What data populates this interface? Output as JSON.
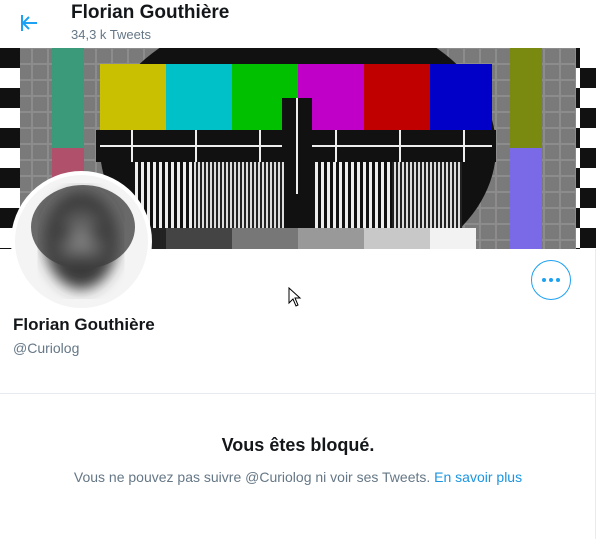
{
  "header": {
    "back_icon": "arrow-left-icon",
    "name": "Florian Gouthière",
    "tweet_count": "34,3 k Tweets"
  },
  "banner": {
    "image": "tv-test-card",
    "colors": {
      "yellow": "#c8c000",
      "cyan": "#00c0c8",
      "green": "#00c000",
      "magenta": "#c000c8",
      "red": "#c00000",
      "blue": "#0000c8"
    }
  },
  "profile": {
    "avatar": "blurred-portrait",
    "name": "Florian Gouthière",
    "handle": "@Curiolog",
    "more_icon": "more-horizontal-icon"
  },
  "blocked": {
    "title": "Vous êtes bloqué.",
    "message": "Vous ne pouvez pas suivre @Curiolog ni voir ses Tweets. ",
    "link_label": "En savoir plus"
  },
  "colors": {
    "accent": "#1da1f2",
    "link": "#1b95e0",
    "text_primary": "#14171a",
    "text_secondary": "#657786",
    "border": "#e6ecf0"
  }
}
